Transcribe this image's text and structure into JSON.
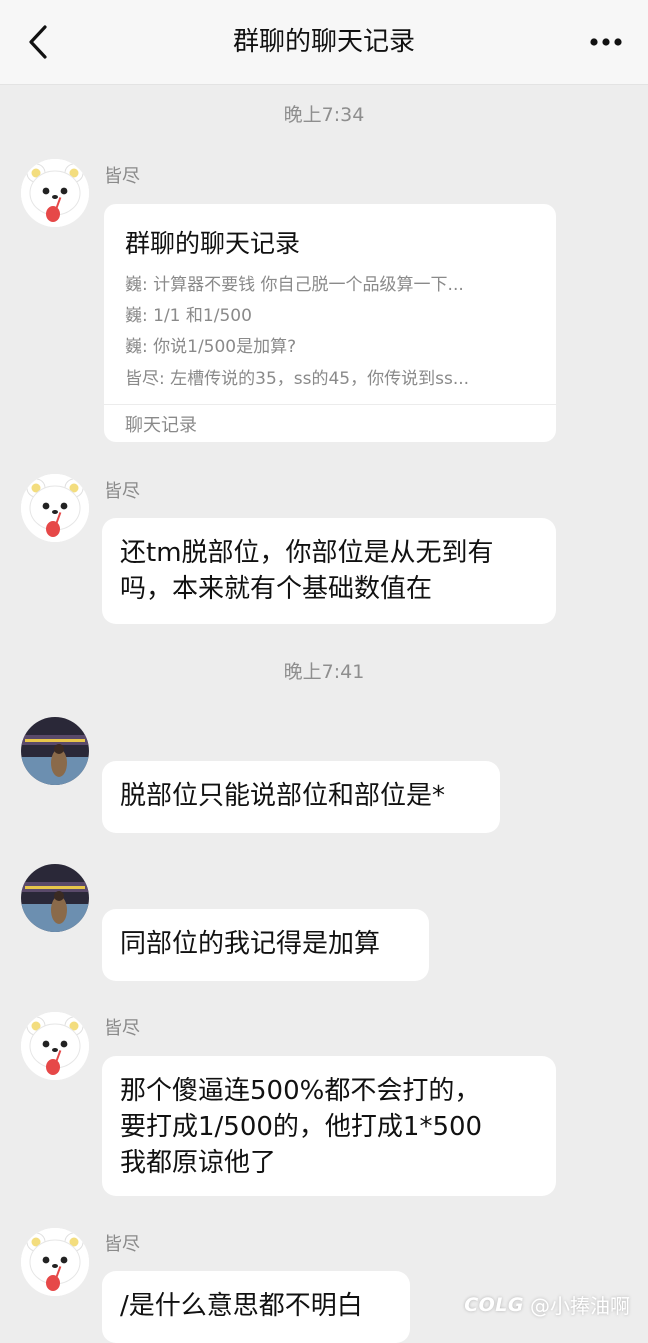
{
  "nav": {
    "title": "群聊的聊天记录",
    "back_icon": "chevron-left-icon",
    "more_icon": "more-horizontal-icon"
  },
  "times": [
    "晚上7:34",
    "晚上7:41"
  ],
  "messages": [
    {
      "sender": "皆尽",
      "card": {
        "title": "群聊的聊天记录",
        "lines": [
          "巍: 计算器不要钱 你自己脱一个品级算一下...",
          "巍: 1/1 和1/500",
          "巍: 你说1/500是加算?",
          "皆尽: 左槽传说的35，ss的45，你传说到ss..."
        ],
        "footer": "聊天记录"
      }
    },
    {
      "sender": "皆尽",
      "lines": [
        "还tm脱部位，你部位是从无到有",
        "吗，本来就有个基础数值在"
      ]
    },
    {
      "sender": "",
      "lines": [
        "脱部位只能说部位和部位是*"
      ]
    },
    {
      "sender": "",
      "lines": [
        "同部位的我记得是加算"
      ]
    },
    {
      "sender": "皆尽",
      "lines": [
        "那个傻逼连500%都不会打的，",
        "要打成1/500的，他打成1*500",
        "我都原谅他了"
      ]
    },
    {
      "sender": "皆尽",
      "lines": [
        "/是什么意思都不明白"
      ]
    }
  ],
  "watermark": {
    "logo": "COLG",
    "text": "@小捧油啊"
  },
  "colors": {
    "background": "#ededed",
    "bubble": "#ffffff",
    "secondary_text": "#8a8a8a"
  }
}
